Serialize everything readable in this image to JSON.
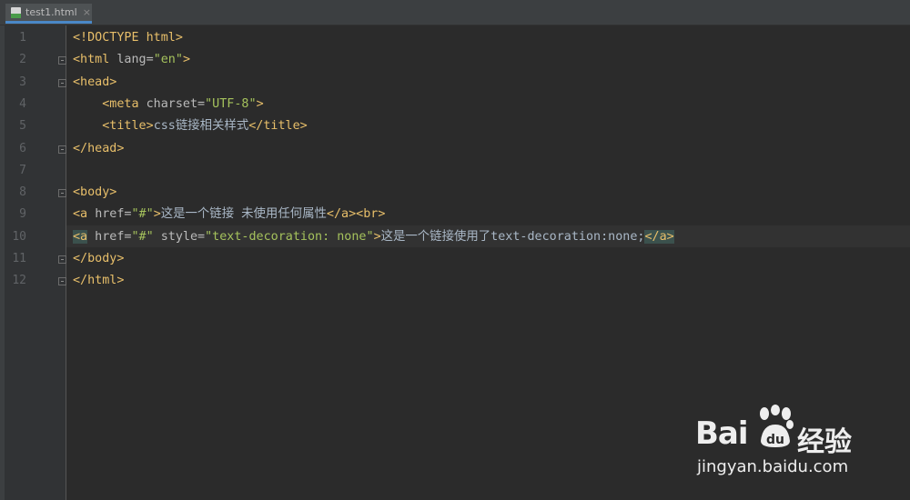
{
  "tab": {
    "label": "test1.html",
    "close_glyph": "×",
    "icon": "html-file-icon"
  },
  "editor": {
    "line_numbers": [
      "1",
      "2",
      "3",
      "4",
      "5",
      "6",
      "7",
      "8",
      "9",
      "10",
      "11",
      "12"
    ],
    "lines": [
      [
        {
          "c": "t-doc",
          "t": "<!DOCTYPE html>"
        }
      ],
      [
        {
          "c": "t-tag",
          "t": "<html "
        },
        {
          "c": "t-attr",
          "t": "lang="
        },
        {
          "c": "t-val",
          "t": "\"en\""
        },
        {
          "c": "t-tag",
          "t": ">"
        }
      ],
      [
        {
          "c": "t-tag",
          "t": "<head>"
        }
      ],
      [
        {
          "c": "t-text",
          "t": "    "
        },
        {
          "c": "t-tag",
          "t": "<meta "
        },
        {
          "c": "t-attr",
          "t": "charset="
        },
        {
          "c": "t-val",
          "t": "\"UTF-8\""
        },
        {
          "c": "t-tag",
          "t": ">"
        }
      ],
      [
        {
          "c": "t-text",
          "t": "    "
        },
        {
          "c": "t-tag",
          "t": "<title>"
        },
        {
          "c": "t-text",
          "t": "css链接相关样式"
        },
        {
          "c": "t-tag",
          "t": "</title>"
        }
      ],
      [
        {
          "c": "t-tag",
          "t": "</head>"
        }
      ],
      [],
      [
        {
          "c": "t-tag",
          "t": "<body>"
        }
      ],
      [
        {
          "c": "t-tag",
          "t": "<a "
        },
        {
          "c": "t-attr",
          "t": "href="
        },
        {
          "c": "t-val",
          "t": "\"#\""
        },
        {
          "c": "t-tag",
          "t": ">"
        },
        {
          "c": "t-text",
          "t": "这是一个链接 未使用任何属性"
        },
        {
          "c": "t-tag",
          "t": "</a><br>"
        }
      ],
      [
        {
          "c": "t-tag hl",
          "t": "<a"
        },
        {
          "c": "t-attr",
          "t": " href="
        },
        {
          "c": "t-val",
          "t": "\"#\""
        },
        {
          "c": "t-attr",
          "t": " style="
        },
        {
          "c": "t-val",
          "t": "\"text-decoration: none\""
        },
        {
          "c": "t-tag",
          "t": ">"
        },
        {
          "c": "t-text",
          "t": "这是一个链接使用了text-decoration:none;"
        },
        {
          "c": "t-tag hl",
          "t": "</a>"
        }
      ],
      [
        {
          "c": "t-tag",
          "t": "</body>"
        }
      ],
      [
        {
          "c": "t-tag",
          "t": "</html>"
        }
      ]
    ],
    "folds": [
      {
        "line": 2,
        "type": "open"
      },
      {
        "line": 3,
        "type": "open"
      },
      {
        "line": 6,
        "type": "close"
      },
      {
        "line": 8,
        "type": "open"
      },
      {
        "line": 11,
        "type": "close"
      },
      {
        "line": 12,
        "type": "close"
      }
    ],
    "current_line": 10
  },
  "watermark": {
    "logo": "Bai",
    "logo_suffix": "du",
    "cn": "经验",
    "url": "jingyan.baidu.com"
  }
}
